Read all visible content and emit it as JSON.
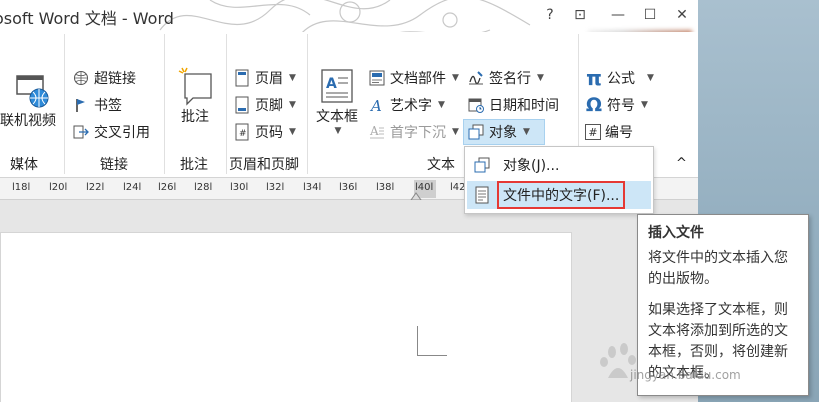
{
  "window": {
    "title": "osoft Word 文档 - Word",
    "help": "?",
    "restore_ribbon": "⊡",
    "minimize": "—",
    "maximize": "☐",
    "close": "✕"
  },
  "ribbon": {
    "media": {
      "button": "联机视频",
      "group": "媒体"
    },
    "links": {
      "items": [
        "超链接",
        "书签",
        "交叉引用"
      ],
      "group": "链接"
    },
    "comments": {
      "button": "批注",
      "group": "批注"
    },
    "header_footer": {
      "items": [
        "页眉",
        "页脚",
        "页码"
      ],
      "group": "页眉和页脚"
    },
    "text": {
      "textbox": "文本框",
      "quickparts": "文档部件",
      "wordart": "艺术字",
      "dropcap": "首字下沉",
      "signature": "签名行",
      "datetime": "日期和时间",
      "object": "对象",
      "group": "文本"
    },
    "symbols": {
      "equation": "公式",
      "symbol": "符号",
      "number": "编号",
      "equation_glyph": "π",
      "symbol_glyph": "Ω",
      "number_glyph": "#"
    },
    "collapse": "^"
  },
  "ruler": {
    "ticks": [
      "l18l",
      "l20l",
      "l22l",
      "l24l",
      "l26l",
      "l28l",
      "l30l",
      "l32l",
      "l34l",
      "l36l",
      "l38l",
      "l40l",
      "l42"
    ]
  },
  "object_menu": {
    "items": [
      "对象(J)...",
      "文件中的文字(F)..."
    ]
  },
  "tooltip": {
    "title": "插入文件",
    "body1": "将文件中的文本插入您的出版物。",
    "body2": "如果选择了文本框，则文本将添加到所选的文本框，否则，将创建新的文本框。"
  },
  "watermark": "jingyan.baidu.com",
  "colors": {
    "highlight": "#cde6f7",
    "highlight_border": "#e53935",
    "accent_blue": "#2b6cb0"
  }
}
